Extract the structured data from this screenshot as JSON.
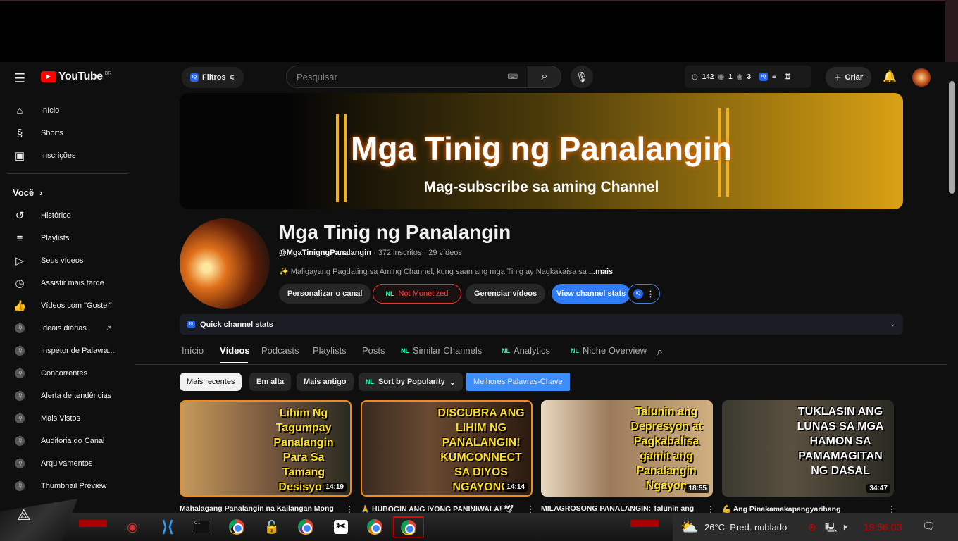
{
  "header": {
    "logo": "YouTube",
    "region": "BR",
    "filters": "Filtros",
    "search_placeholder": "Pesquisar",
    "stats": {
      "watch": "142",
      "views1": "1",
      "views2": "3"
    },
    "create": "Criar"
  },
  "sidebar": {
    "main": [
      {
        "label": "Início",
        "icon": "home-icon"
      },
      {
        "label": "Shorts",
        "icon": "shorts-icon"
      },
      {
        "label": "Inscrições",
        "icon": "subscriptions-icon"
      }
    ],
    "you": "Você",
    "you_items": [
      {
        "label": "Histórico"
      },
      {
        "label": "Playlists"
      },
      {
        "label": "Seus vídeos"
      },
      {
        "label": "Assistir mais tarde"
      },
      {
        "label": "Vídeos com \"Gostei\""
      }
    ],
    "tools": [
      {
        "label": "Ideais diárias"
      },
      {
        "label": "Inspetor de Palavra..."
      },
      {
        "label": "Concorrentes"
      },
      {
        "label": "Alerta de tendências"
      },
      {
        "label": "Mais Vistos"
      },
      {
        "label": "Auditoria do Canal"
      },
      {
        "label": "Arquivamentos"
      },
      {
        "label": "Thumbnail Preview"
      }
    ]
  },
  "banner": {
    "title": "Mga Tinig ng Panalangin",
    "subtitle": "Mag-subscribe sa aming Channel"
  },
  "channel": {
    "name": "Mga Tinig ng Panalangin",
    "handle": "@MgaTinigngPanalangin",
    "meta": " · 372 inscritos · 29 vídeos",
    "description": "Maligayang Pagdating sa Aming Channel, kung saan ang mga Tinig ay Nagkakaisa sa",
    "more": "...mais",
    "buttons": {
      "customize": "Personalizar o canal",
      "monetized": "Not Monetized",
      "manage": "Gerenciar vídeos",
      "stats": "View channel stats"
    }
  },
  "quick_stats": "Quick channel stats",
  "tabs": [
    "Início",
    "Vídeos",
    "Podcasts",
    "Playlists",
    "Posts",
    "Similar Channels",
    "Analytics",
    "Niche Overview"
  ],
  "chips": [
    "Mais recentes",
    "Em alta",
    "Mais antigo",
    "Sort by Popularity",
    "Melhores Palavras-Chave"
  ],
  "videos": [
    {
      "thumb_text": "Lihim Ng Tagumpay Panalangin Para Sa Tamang Desisyon",
      "duration": "14:19",
      "title": "Mahalagang Panalangin na Kailangan Mong"
    },
    {
      "thumb_text": "DISCUBRA ANG LIHIM NG PANALANGIN! KUMCONNECT SA DIYOS NGAYONG ARAW!",
      "duration": "14:14",
      "title": "🙏 HUBOGIN ANG IYONG PANINIWALA! 🕊"
    },
    {
      "thumb_text": "Talunin ang Depresyon at Pagkabalisa gamit ang Panalangin Ngayon",
      "duration": "18:55",
      "title": "MILAGROSONG PANALANGIN: Talunin ang"
    },
    {
      "thumb_text": "TUKLASIN ANG LUNAS SA MGA HAMON SA PAMAMAGITAN NG DASAL",
      "duration": "34:47",
      "title": "💪 Ang Pinakamakapangyarihang"
    }
  ],
  "taskbar": {
    "temp": "26°C",
    "weather": "Pred. nublado",
    "time": "19:56:03"
  }
}
